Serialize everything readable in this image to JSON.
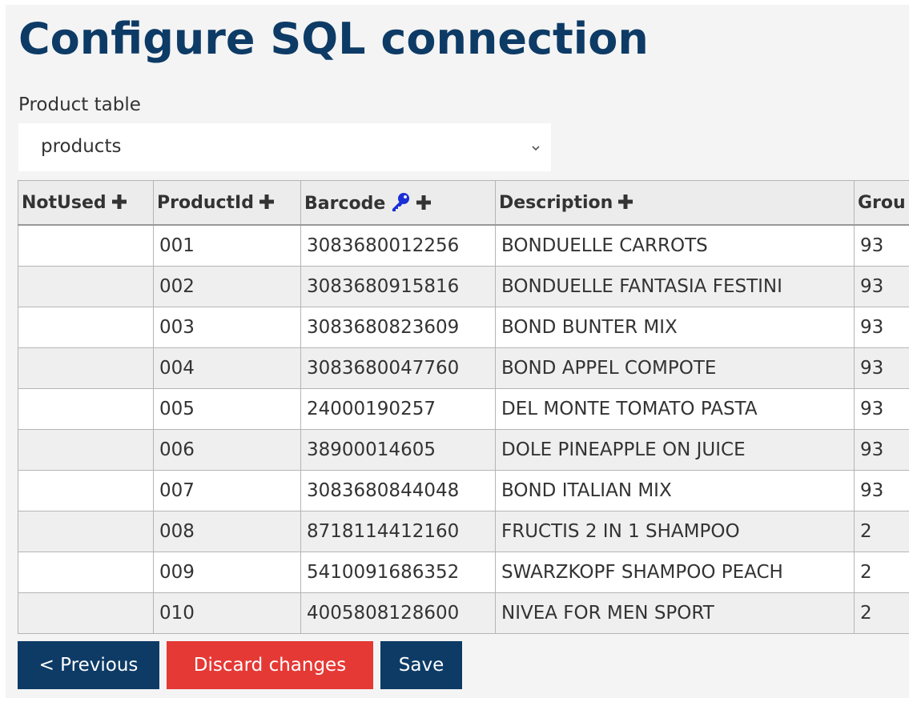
{
  "page": {
    "title": "Configure SQL connection"
  },
  "product_table": {
    "label": "Product table",
    "selected": "products"
  },
  "table": {
    "columns": [
      {
        "label": "NotUsed",
        "has_key": false
      },
      {
        "label": "ProductId",
        "has_key": false
      },
      {
        "label": "Barcode",
        "has_key": true
      },
      {
        "label": "Description",
        "has_key": false
      },
      {
        "label": "Grou",
        "has_key": false
      }
    ],
    "rows": [
      [
        "",
        "001",
        "3083680012256",
        "BONDUELLE CARROTS",
        "93"
      ],
      [
        "",
        "002",
        "3083680915816",
        "BONDUELLE FANTASIA FESTINI",
        "93"
      ],
      [
        "",
        "003",
        "3083680823609",
        "BOND BUNTER MIX",
        "93"
      ],
      [
        "",
        "004",
        "3083680047760",
        "BOND APPEL COMPOTE",
        "93"
      ],
      [
        "",
        "005",
        "24000190257",
        "DEL MONTE TOMATO PASTA",
        "93"
      ],
      [
        "",
        "006",
        "38900014605",
        "DOLE PINEAPPLE ON JUICE",
        "93"
      ],
      [
        "",
        "007",
        "3083680844048",
        "BOND ITALIAN MIX",
        "93"
      ],
      [
        "",
        "008",
        "8718114412160",
        "FRUCTIS 2 IN 1 SHAMPOO",
        "2"
      ],
      [
        "",
        "009",
        "5410091686352",
        "SWARZKOPF SHAMPOO PEACH",
        "2"
      ],
      [
        "",
        "010",
        "4005808128600",
        "NIVEA FOR MEN SPORT",
        "2"
      ]
    ]
  },
  "buttons": {
    "previous": "< Previous",
    "discard": "Discard changes",
    "save": "Save"
  },
  "colors": {
    "title": "#0d3b66",
    "primary_button": "#0d3b66",
    "danger_button": "#e53935",
    "key_icon": "#1a2fd6"
  },
  "icons": {
    "add_column": "plus-icon",
    "primary_key": "key-icon",
    "dropdown": "chevron-down-icon"
  }
}
